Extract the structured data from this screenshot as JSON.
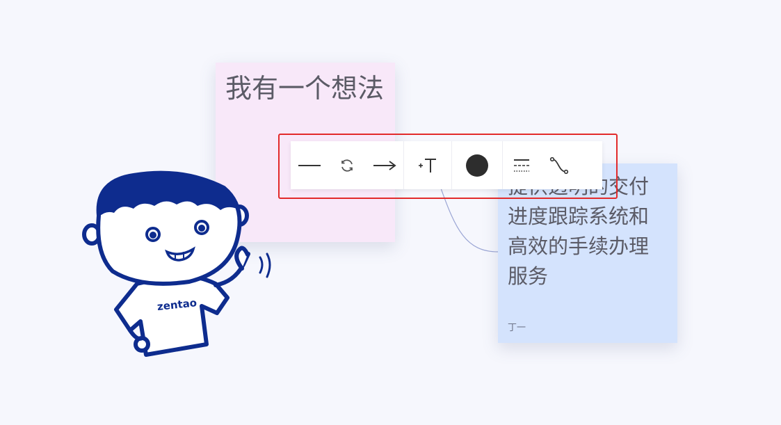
{
  "notes": [
    {
      "title": "我有一个想法",
      "author": "",
      "color": "#f8e8f9"
    },
    {
      "body": "提供透明的交付进度跟踪系统和高效的手续办理服务",
      "author": "丁一",
      "color": "#d4e3fd"
    }
  ],
  "toolbar": {
    "groups": [
      {
        "buttons": [
          {
            "icon": "solid-line-icon"
          },
          {
            "icon": "swap-direction-icon"
          },
          {
            "icon": "arrow-right-icon"
          }
        ]
      },
      {
        "buttons": [
          {
            "icon": "add-text-icon"
          }
        ]
      },
      {
        "buttons": [
          {
            "icon": "color-dot-icon",
            "color": "#2d2d2d"
          }
        ]
      },
      {
        "buttons": [
          {
            "icon": "line-style-icon"
          },
          {
            "icon": "curve-connector-icon"
          }
        ]
      }
    ],
    "highlight_color": "#e22a2a"
  },
  "mascot": {
    "shirt_text": "zentao",
    "color": "#0e2c8e"
  }
}
